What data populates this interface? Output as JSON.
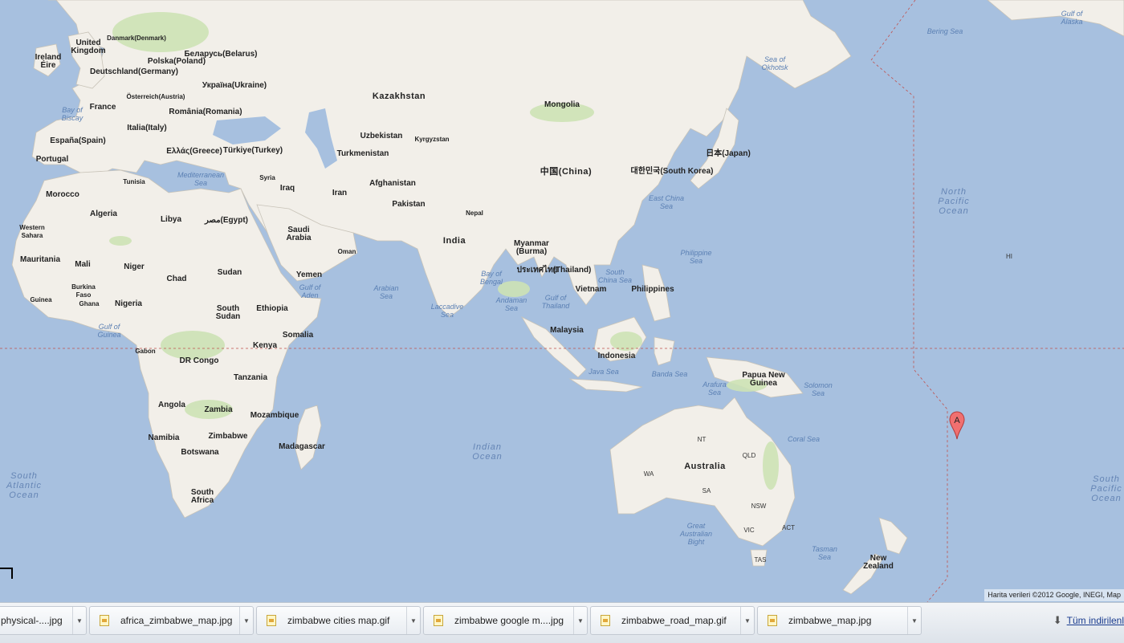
{
  "map": {
    "labels": {
      "ireland": "Ireland",
      "eire": "Éire",
      "uk": "United Kingdom",
      "denmark": "Danmark",
      "denmark_sub": "(Denmark)",
      "belarus": "Беларусь",
      "belarus_sub": "(Belarus)",
      "polska": "Polska",
      "polska_sub": "(Poland)",
      "deutschland": "Deutschland",
      "deutschland_sub": "(Germany)",
      "ukraine": "Україна",
      "ukraine_sub": "(Ukraine)",
      "osterreich": "Österreich",
      "osterreich_sub": "(Austria)",
      "romania": "România",
      "romania_sub": "(Romania)",
      "france": "France",
      "italia": "Italia",
      "italia_sub": "(Italy)",
      "espana": "España",
      "espana_sub": "(Spain)",
      "portugal": "Portugal",
      "greece": "Ελλάς",
      "greece_sub": "(Greece)",
      "turkiye": "Türkiye",
      "turkiye_sub": "(Turkey)",
      "bay_biscay": "Bay of Biscay",
      "med_sea": "Mediterranean Sea",
      "kazakhstan": "Kazakhstan",
      "uzbekistan": "Uzbekistan",
      "kyrgyzstan": "Kyrgyzstan",
      "turkmenistan": "Turkmenistan",
      "syria": "Syria",
      "iraq": "Iraq",
      "iran": "Iran",
      "afghanistan": "Afghanistan",
      "pakistan": "Pakistan",
      "nepal": "Nepal",
      "india": "India",
      "mongolia": "Mongolia",
      "china": "中国",
      "china_sub": "(China)",
      "korea": "대한민국",
      "korea_sub": "(South Korea)",
      "japan": "日本",
      "japan_sub": "(Japan)",
      "sea_okhotsk": "Sea of Okhotsk",
      "bering_sea": "Bering Sea",
      "gulf_alaska": "Gulf of Alaska",
      "east_china_sea": "East China Sea",
      "morocco": "Morocco",
      "tunisia": "Tunisia",
      "algeria": "Algeria",
      "libya": "Libya",
      "egypt": "مصر",
      "egypt_sub": "(Egypt)",
      "saudi_arabia": "Saudi Arabia",
      "oman": "Oman",
      "yemen": "Yemen",
      "western_sahara": "Western Sahara",
      "mauritania": "Mauritania",
      "mali": "Mali",
      "niger": "Niger",
      "chad": "Chad",
      "sudan": "Sudan",
      "burkina_faso": "Burkina Faso",
      "guinea": "Guinea",
      "ghana": "Ghana",
      "nigeria": "Nigeria",
      "south_sudan": "South Sudan",
      "ethiopia": "Ethiopia",
      "somalia": "Somalia",
      "kenya": "Kenya",
      "gabon": "Gabon",
      "dr_congo": "DR Congo",
      "tanzania": "Tanzania",
      "angola": "Angola",
      "zambia": "Zambia",
      "mozambique": "Mozambique",
      "namibia": "Namibia",
      "zimbabwe": "Zimbabwe",
      "botswana": "Botswana",
      "madagascar": "Madagascar",
      "south_africa": "South Africa",
      "gulf_aden": "Gulf of Aden",
      "arabian_sea": "Arabian Sea",
      "bay_bengal": "Bay of Bengal",
      "laccadive_sea": "Laccadive Sea",
      "myanmar": "Myanmar (Burma)",
      "thailand": "ประเทศไทย",
      "thailand_sub": "(Thailand)",
      "andaman_sea": "Andaman Sea",
      "gulf_thailand": "Gulf of Thailand",
      "vietnam": "Vietnam",
      "south_china_sea": "South China Sea",
      "philippines": "Philippines",
      "philippine_sea": "Philippine Sea",
      "malaysia": "Malaysia",
      "indonesia": "Indonesia",
      "java_sea": "Java Sea",
      "banda_sea": "Banda Sea",
      "arafura_sea": "Arafura Sea",
      "png": "Papua New Guinea",
      "solomon_sea": "Solomon Sea",
      "coral_sea": "Coral Sea",
      "australia": "Australia",
      "nt": "NT",
      "qld": "QLD",
      "wa": "WA",
      "sa": "SA",
      "nsw": "NSW",
      "act": "ACT",
      "vic": "VIC",
      "tas": "TAS",
      "great_australian_bight": "Great Australian Bight",
      "tasman_sea": "Tasman Sea",
      "new_zealand": "New Zealand",
      "north_pacific": "North Pacific Ocean",
      "hi": "HI",
      "indian_ocean": "Indian Ocean",
      "south_atlantic": "South Atlantic Ocean",
      "south_pacific": "South Pacific Ocean",
      "gulf_guinea": "Gulf of Guinea"
    },
    "marker_label": "A",
    "attribution": "Harita verileri ©2012 Google, INEGI, Map"
  },
  "downloads": {
    "items": [
      {
        "name": "physical-....jpg"
      },
      {
        "name": "africa_zimbabwe_map.jpg"
      },
      {
        "name": "zimbabwe cities map.gif"
      },
      {
        "name": "zimbabwe google m....jpg"
      },
      {
        "name": "zimbabwe_road_map.gif"
      },
      {
        "name": "zimbabwe_map.jpg"
      }
    ],
    "show_all": "Tüm indirilenl"
  },
  "colors": {
    "ocean": "#a7c0df",
    "land": "#f2efe9",
    "vegetation": "#cde2b5",
    "border": "#9a9a9a",
    "dateline": "#c0504d"
  }
}
